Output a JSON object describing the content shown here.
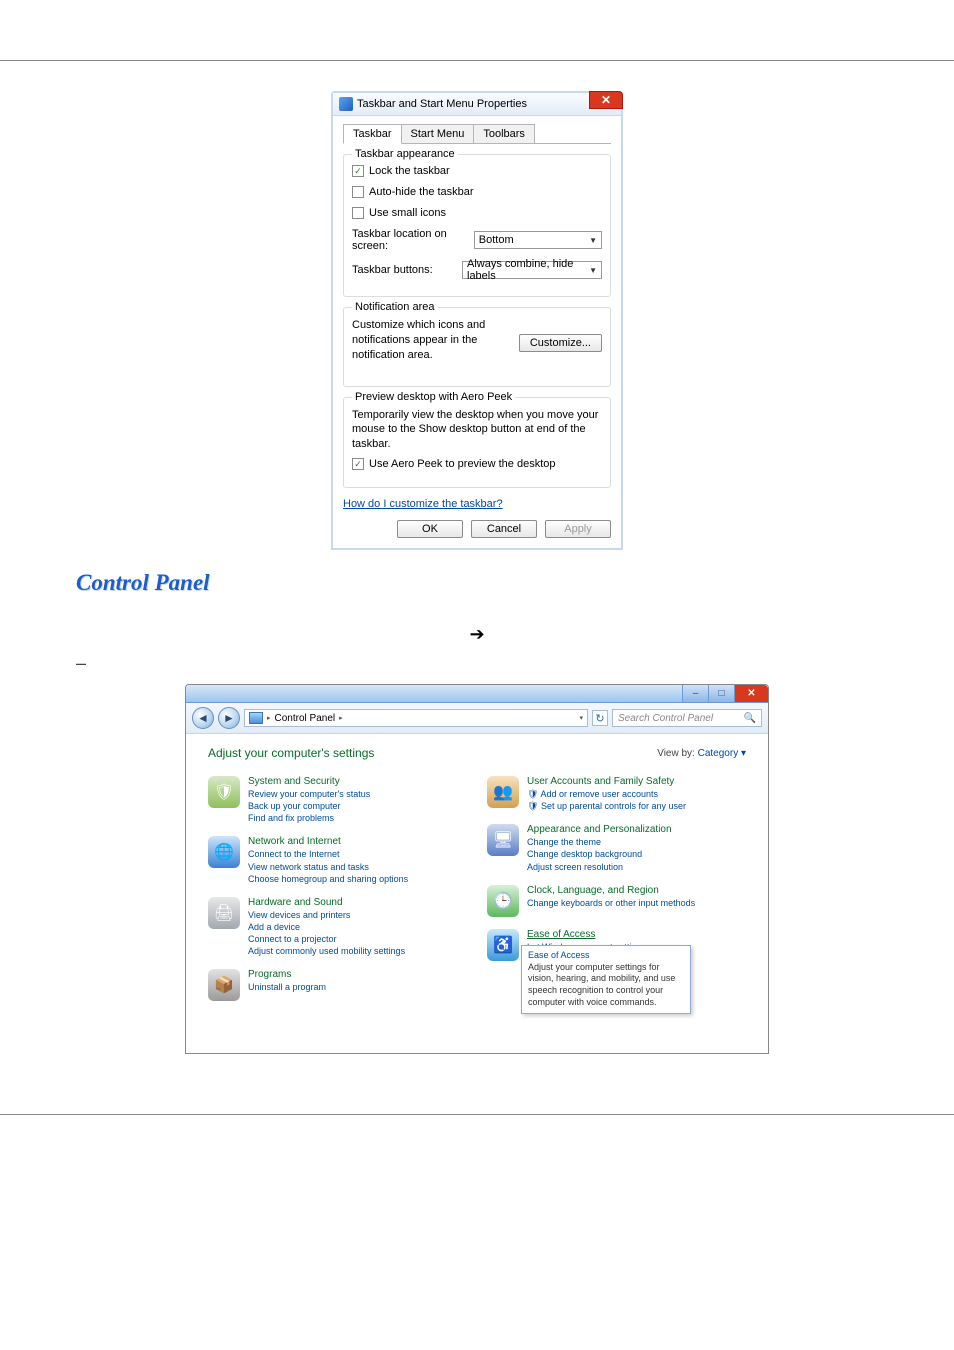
{
  "dialog": {
    "title": "Taskbar and Start Menu Properties",
    "tabs": [
      "Taskbar",
      "Start Menu",
      "Toolbars"
    ],
    "appearance_legend": "Taskbar appearance",
    "lock": "Lock the taskbar",
    "autohide": "Auto-hide the taskbar",
    "small": "Use small icons",
    "loc_label": "Taskbar location on screen:",
    "loc_value": "Bottom",
    "btn_label": "Taskbar buttons:",
    "btn_value": "Always combine, hide labels",
    "notif_legend": "Notification area",
    "notif_text": "Customize which icons and notifications appear in the notification area.",
    "customize": "Customize...",
    "peek_legend": "Preview desktop with Aero Peek",
    "peek_text": "Temporarily view the desktop when you move your mouse to the Show desktop button at end of the taskbar.",
    "peek_cb": "Use Aero Peek to preview the desktop",
    "help": "How do I customize the taskbar?",
    "ok": "OK",
    "cancel": "Cancel",
    "apply": "Apply"
  },
  "section_title": "Control Panel",
  "arrow": "➔",
  "dash": "–",
  "cp": {
    "breadcrumb_text": "Control Panel",
    "search_placeholder": "Search Control Panel",
    "header": "Adjust your computer's settings",
    "view_label": "View by:",
    "view_value": "Category ▾",
    "left": [
      {
        "cat": "System and Security",
        "subs": [
          "Review your computer's status",
          "Back up your computer",
          "Find and fix problems"
        ],
        "ico": "sec"
      },
      {
        "cat": "Network and Internet",
        "subs": [
          "Connect to the Internet",
          "View network status and tasks",
          "Choose homegroup and sharing options"
        ],
        "ico": "net"
      },
      {
        "cat": "Hardware and Sound",
        "subs": [
          "View devices and printers",
          "Add a device",
          "Connect to a projector",
          "Adjust commonly used mobility settings"
        ],
        "ico": "hw"
      },
      {
        "cat": "Programs",
        "subs": [
          "Uninstall a program"
        ],
        "ico": "prg"
      }
    ],
    "right": [
      {
        "cat": "User Accounts and Family Safety",
        "subs_shield": [
          "Add or remove user accounts",
          "Set up parental controls for any user"
        ],
        "ico": "usr"
      },
      {
        "cat": "Appearance and Personalization",
        "subs": [
          "Change the theme",
          "Change desktop background",
          "Adjust screen resolution"
        ],
        "ico": "appx"
      },
      {
        "cat": "Clock, Language, and Region",
        "subs": [
          "Change keyboards or other input methods"
        ],
        "ico": "clk"
      },
      {
        "cat": "Ease of Access",
        "cat_ul": true,
        "subs": [
          "Let Windows suggest settings"
        ],
        "ico": "eoa",
        "tip_title": "Ease of Access",
        "tip_body": "Adjust your computer settings for vision, hearing, and mobility, and use speech recognition to control your computer with voice commands."
      }
    ]
  }
}
